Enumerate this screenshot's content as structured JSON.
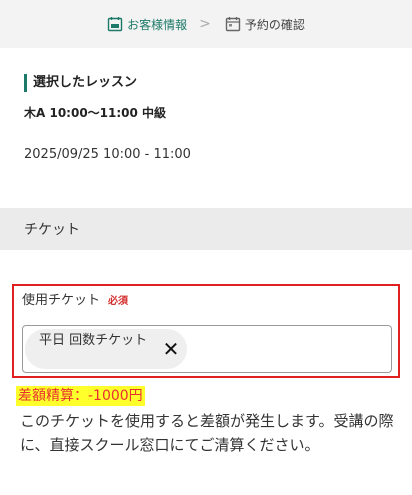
{
  "steps": [
    {
      "label": "お客様情報",
      "icon": "user-card-icon"
    },
    {
      "label": "予約の確認",
      "icon": "calendar-icon"
    }
  ],
  "step_separator": ">",
  "lesson": {
    "section_title": "選択したレッスン",
    "class_name": "木A 10:00〜11:00 中級",
    "datetime": "2025/09/25 10:00 - 11:00"
  },
  "ticket": {
    "section_title": "チケット",
    "field_label": "使用チケット",
    "required_label": "必須",
    "selected_ticket": "平日 回数チケット",
    "clear_icon": "✕"
  },
  "difference": {
    "label": "差額精算：-1000円",
    "notice": "このチケットを使用すると差額が発生します。受講の際に、直接スクール窓口にてご清算ください。"
  },
  "colors": {
    "accent": "#1d7a68",
    "error_border": "#e02020",
    "highlight": "#ffff2b",
    "diff_text": "#e83030"
  }
}
